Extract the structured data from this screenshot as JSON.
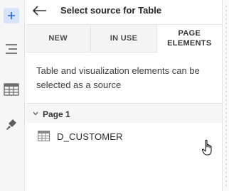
{
  "panel": {
    "title": "Select source for Table"
  },
  "tabs": [
    {
      "label": "NEW",
      "active": false
    },
    {
      "label": "IN USE",
      "active": false
    },
    {
      "label": "PAGE ELEMENTS",
      "active": true
    }
  ],
  "description": "Table and visualization elements can be selected as a source",
  "groups": [
    {
      "label": "Page 1",
      "expanded": true,
      "items": [
        {
          "label": "D_CUSTOMER",
          "icon": "table-icon"
        }
      ]
    }
  ],
  "rail": {
    "items": [
      {
        "icon": "plus-icon",
        "active": true
      },
      {
        "icon": "layout-icon",
        "active": false
      },
      {
        "icon": "table-icon",
        "active": false
      },
      {
        "icon": "paint-brush-icon",
        "active": false
      }
    ]
  },
  "colors": {
    "accent": "#2f6fe0",
    "rail_active_bg": "#d6e4fb",
    "group_bg": "#f6f6f6"
  }
}
